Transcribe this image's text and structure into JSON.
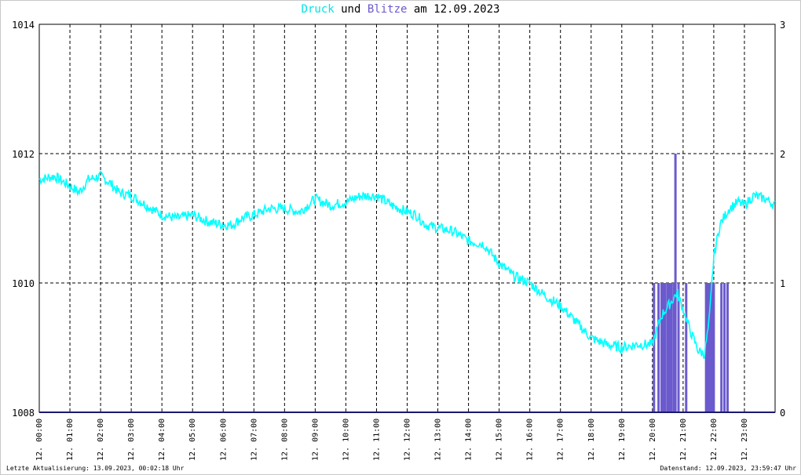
{
  "title": {
    "part1": "Druck",
    "part2": " und ",
    "part3": "Blitze",
    "part4": " am 12.09.2023"
  },
  "colors": {
    "pressure": "#00ffff",
    "lightning": "#6a5acd",
    "baseline": "#191970",
    "grid": "#000000"
  },
  "footer": {
    "left": "Letzte Aktualisierung: 13.09.2023, 00:02:18 Uhr",
    "right": "Datenstand: 12.09.2023, 23:59:47 Uhr"
  },
  "chart_data": {
    "type": "line",
    "title": "Druck und Blitze am 12.09.2023",
    "grid": true,
    "y_left": {
      "range": [
        1008,
        1014
      ],
      "ticks": [
        "1008",
        "1010",
        "1012",
        "1014"
      ]
    },
    "y_right": {
      "range": [
        0,
        3
      ],
      "ticks": [
        "0",
        "1",
        "2",
        "3"
      ]
    },
    "x_range_hours": [
      0,
      24
    ],
    "x_ticks": [
      {
        "h": 0,
        "label": "12. 00:00"
      },
      {
        "h": 1,
        "label": "12. 01:00"
      },
      {
        "h": 2,
        "label": "12. 02:00"
      },
      {
        "h": 3,
        "label": "12. 03:00"
      },
      {
        "h": 4,
        "label": "12. 04:00"
      },
      {
        "h": 5,
        "label": "12. 05:00"
      },
      {
        "h": 6,
        "label": "12. 06:00"
      },
      {
        "h": 7,
        "label": "12. 07:00"
      },
      {
        "h": 8,
        "label": "12. 08:00"
      },
      {
        "h": 9,
        "label": "12. 09:00"
      },
      {
        "h": 10,
        "label": "12. 10:00"
      },
      {
        "h": 11,
        "label": "12. 11:00"
      },
      {
        "h": 12,
        "label": "12. 12:00"
      },
      {
        "h": 13,
        "label": "12. 13:00"
      },
      {
        "h": 14,
        "label": "12. 14:00"
      },
      {
        "h": 15,
        "label": "12. 15:00"
      },
      {
        "h": 16,
        "label": "12. 16:00"
      },
      {
        "h": 17,
        "label": "12. 17:00"
      },
      {
        "h": 18,
        "label": "12. 18:00"
      },
      {
        "h": 19,
        "label": "12. 19:00"
      },
      {
        "h": 20,
        "label": "12. 20:00"
      },
      {
        "h": 21,
        "label": "12. 21:00"
      },
      {
        "h": 22,
        "label": "12. 22:00"
      },
      {
        "h": 23,
        "label": "12. 23:00"
      }
    ],
    "series": [
      {
        "name": "Druck",
        "axis": "left",
        "points": [
          [
            0.0,
            1011.6
          ],
          [
            0.5,
            1011.65
          ],
          [
            1.0,
            1011.5
          ],
          [
            1.3,
            1011.4
          ],
          [
            1.6,
            1011.6
          ],
          [
            2.0,
            1011.65
          ],
          [
            2.3,
            1011.55
          ],
          [
            2.6,
            1011.4
          ],
          [
            3.0,
            1011.35
          ],
          [
            3.5,
            1011.2
          ],
          [
            4.0,
            1011.05
          ],
          [
            4.5,
            1011.0
          ],
          [
            5.0,
            1011.05
          ],
          [
            5.5,
            1010.95
          ],
          [
            6.0,
            1010.9
          ],
          [
            6.3,
            1010.9
          ],
          [
            6.6,
            1011.0
          ],
          [
            7.0,
            1011.05
          ],
          [
            7.5,
            1011.15
          ],
          [
            8.0,
            1011.15
          ],
          [
            8.5,
            1011.1
          ],
          [
            9.0,
            1011.3
          ],
          [
            9.5,
            1011.2
          ],
          [
            10.0,
            1011.25
          ],
          [
            10.5,
            1011.35
          ],
          [
            11.0,
            1011.35
          ],
          [
            11.5,
            1011.2
          ],
          [
            12.0,
            1011.1
          ],
          [
            12.3,
            1011.05
          ],
          [
            12.6,
            1010.9
          ],
          [
            13.0,
            1010.85
          ],
          [
            13.5,
            1010.8
          ],
          [
            14.0,
            1010.65
          ],
          [
            14.5,
            1010.6
          ],
          [
            15.0,
            1010.3
          ],
          [
            15.5,
            1010.1
          ],
          [
            16.0,
            1010.0
          ],
          [
            16.5,
            1009.8
          ],
          [
            17.0,
            1009.65
          ],
          [
            17.5,
            1009.4
          ],
          [
            18.0,
            1009.15
          ],
          [
            18.5,
            1009.05
          ],
          [
            19.0,
            1009.0
          ],
          [
            19.5,
            1009.05
          ],
          [
            20.0,
            1009.05
          ],
          [
            20.3,
            1009.5
          ],
          [
            20.6,
            1009.7
          ],
          [
            20.8,
            1009.85
          ],
          [
            21.0,
            1009.6
          ],
          [
            21.2,
            1009.3
          ],
          [
            21.5,
            1008.95
          ],
          [
            21.7,
            1008.9
          ],
          [
            21.85,
            1009.4
          ],
          [
            22.0,
            1010.4
          ],
          [
            22.2,
            1010.9
          ],
          [
            22.5,
            1011.15
          ],
          [
            22.8,
            1011.25
          ],
          [
            23.0,
            1011.2
          ],
          [
            23.3,
            1011.35
          ],
          [
            23.7,
            1011.3
          ],
          [
            24.0,
            1011.2
          ]
        ]
      },
      {
        "name": "Blitze",
        "axis": "right",
        "type": "bar",
        "points": [
          [
            20.05,
            1
          ],
          [
            20.2,
            1
          ],
          [
            20.3,
            1
          ],
          [
            20.35,
            1
          ],
          [
            20.42,
            1
          ],
          [
            20.5,
            1
          ],
          [
            20.55,
            1
          ],
          [
            20.62,
            1
          ],
          [
            20.7,
            1
          ],
          [
            20.75,
            2
          ],
          [
            20.85,
            1
          ],
          [
            21.1,
            1
          ],
          [
            21.75,
            1
          ],
          [
            21.8,
            1
          ],
          [
            21.85,
            1
          ],
          [
            21.9,
            1
          ],
          [
            21.95,
            1
          ],
          [
            22.0,
            1
          ],
          [
            22.25,
            1
          ],
          [
            22.35,
            1
          ],
          [
            22.45,
            1
          ]
        ]
      }
    ]
  }
}
